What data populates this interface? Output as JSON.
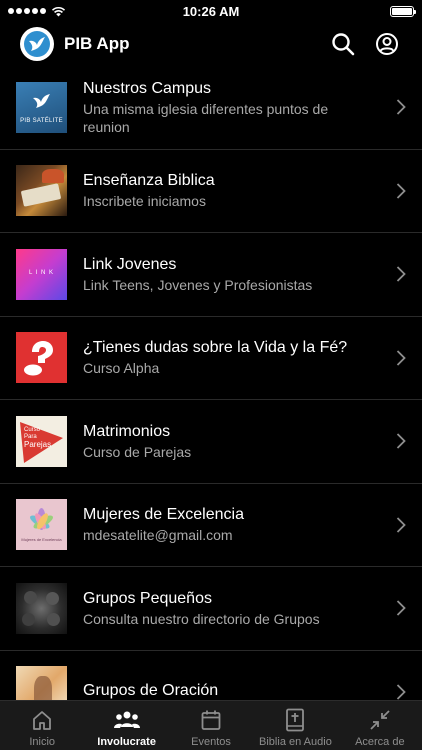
{
  "status_bar": {
    "time": "10:26 AM"
  },
  "header": {
    "app_title": "PIB App"
  },
  "thumbs": {
    "campus_caption": "PIB SATÉLITE",
    "link_caption": "L I N K",
    "parejas_line1": "Curso",
    "parejas_line2": "Para",
    "parejas_line3": "Parejas",
    "mujeres_caption": "Mujeres de Excelencia"
  },
  "items": [
    {
      "title": "Nuestros Campus",
      "subtitle": "Una misma iglesia diferentes puntos de reunion"
    },
    {
      "title": "Enseñanza Biblica",
      "subtitle": "Inscribete iniciamos"
    },
    {
      "title": "Link Jovenes",
      "subtitle": "Link Teens, Jovenes y Profesionistas"
    },
    {
      "title": "¿Tienes dudas sobre la Vida y la Fé?",
      "subtitle": "Curso Alpha"
    },
    {
      "title": "Matrimonios",
      "subtitle": "Curso de Parejas"
    },
    {
      "title": "Mujeres de Excelencia",
      "subtitle": "mdesatelite@gmail.com"
    },
    {
      "title": "Grupos Pequeños",
      "subtitle": "Consulta nuestro directorio de Grupos"
    },
    {
      "title": "Grupos de Oración",
      "subtitle": ""
    }
  ],
  "tabs": [
    {
      "label": "Inicio",
      "icon": "home-icon"
    },
    {
      "label": "Involucrate",
      "icon": "people-icon"
    },
    {
      "label": "Eventos",
      "icon": "calendar-icon"
    },
    {
      "label": "Biblia en Audio",
      "icon": "bible-icon"
    },
    {
      "label": "Acerca de",
      "icon": "collapse-arrows-icon"
    }
  ],
  "colors": {
    "background": "#000000",
    "tab_bar": "#1a1a1a",
    "subtitle": "#a9a9a9",
    "active_tab": "#ffffff",
    "inactive_tab": "#8e8e8e",
    "logo_blue": "#2f8fcf"
  },
  "active_tab": "Involucrate"
}
